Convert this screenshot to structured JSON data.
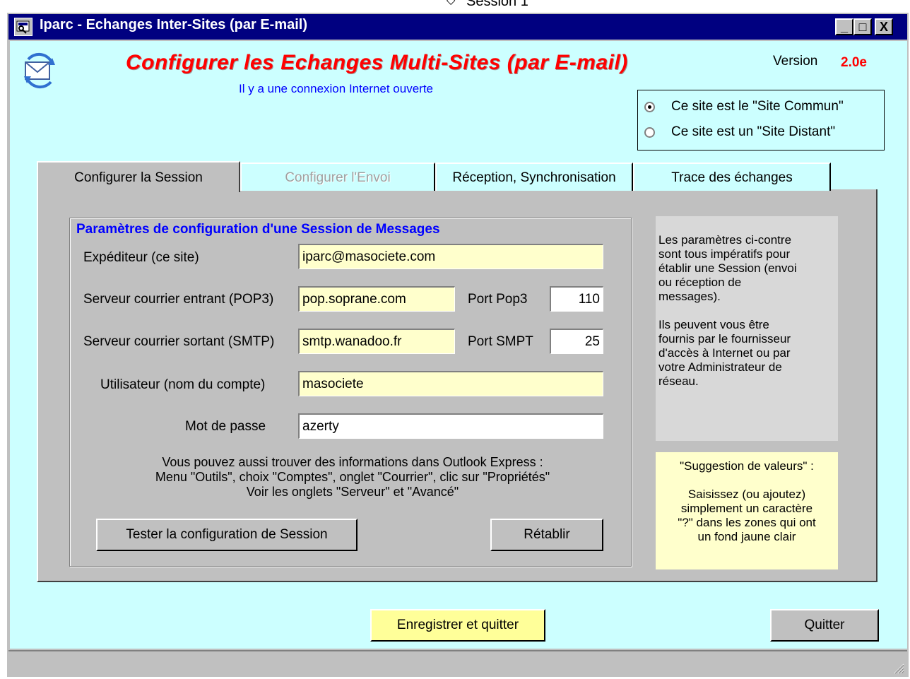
{
  "top_strip": {
    "label": "Session 1"
  },
  "window": {
    "title": "Iparc - Echanges Inter-Sites (par E-mail)",
    "controls": {
      "minimize": "_",
      "maximize": "□",
      "close": "X"
    }
  },
  "header": {
    "heading": "Configurer les Echanges Multi-Sites (par E-mail)",
    "subheading": "Il y a une connexion Internet ouverte",
    "version_label": "Version",
    "version_value": "2.0e"
  },
  "site_mode": {
    "options": [
      {
        "label": "Ce site est le \"Site Commun\"",
        "selected": true
      },
      {
        "label": "Ce site est un \"Site Distant\"",
        "selected": false
      }
    ]
  },
  "tabs": [
    {
      "label": "Configurer la Session",
      "active": true,
      "enabled": true
    },
    {
      "label": "Configurer l'Envoi",
      "active": false,
      "enabled": false
    },
    {
      "label": "Réception, Synchronisation",
      "active": false,
      "enabled": true
    },
    {
      "label": "Trace des échanges",
      "active": false,
      "enabled": true
    }
  ],
  "session": {
    "group_title": "Paramètres de configuration d'une Session de Messages",
    "sender_label": "Expéditeur (ce site)",
    "sender_value": "iparc@masociete.com",
    "pop3_label": "Serveur courrier entrant (POP3)",
    "pop3_value": "pop.soprane.com",
    "pop3_port_label": "Port Pop3",
    "pop3_port_value": "110",
    "smtp_label": "Serveur courrier sortant (SMTP)",
    "smtp_value": "smtp.wanadoo.fr",
    "smtp_port_label": "Port SMPT",
    "smtp_port_value": "25",
    "user_label": "Utilisateur (nom du compte)",
    "user_value": "masociete",
    "password_label": "Mot de passe",
    "password_value": "azerty",
    "info_line1": "Vous pouvez aussi trouver des informations dans Outlook Express :",
    "info_line2": "Menu \"Outils\", choix \"Comptes\", onglet \"Courrier\", clic sur \"Propriétés\"",
    "info_line3": "Voir les onglets \"Serveur\" et \"Avancé\"",
    "test_button": "Tester la configuration de Session",
    "reset_button": "Rétablir"
  },
  "help": {
    "text": "Les paramètres ci-contre\nsont tous impératifs pour\nétablir une Session (envoi\nou réception de\nmessages).\n\nIls peuvent vous être\nfournis par le fournisseur\nd'accès à Internet ou par\nvotre Administrateur de\nréseau."
  },
  "suggestion": {
    "text": "\"Suggestion de valeurs\" :\n\nSaisissez (ou ajoutez)\nsimplement un caractère\n\"?\" dans les zones qui ont\nun fond jaune clair"
  },
  "footer": {
    "save_button": "Enregistrer et quitter",
    "quit_button": "Quitter"
  },
  "colors": {
    "titlebar": "#000080",
    "client_background": "#ccffff",
    "heading": "#ff0000",
    "subheading": "#0000ff",
    "field_highlight": "#ffffcc",
    "save_button": "#ffff99"
  },
  "icons": [
    "app-window-icon",
    "email-sync-icon",
    "resize-grip-icon"
  ]
}
